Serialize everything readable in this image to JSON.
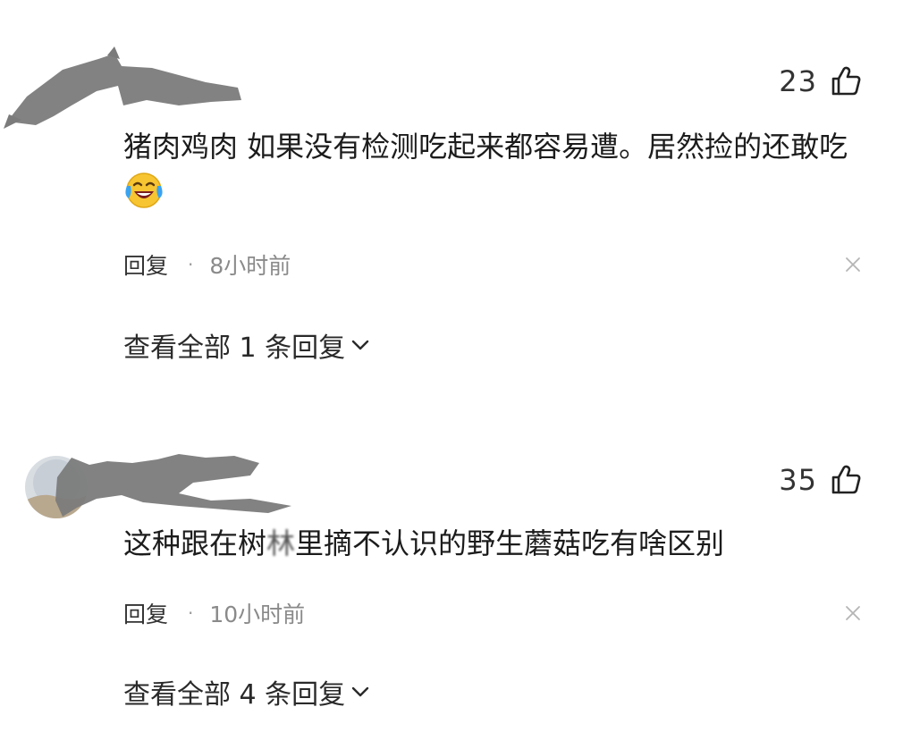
{
  "comments": [
    {
      "likes": "23",
      "text": "猪肉鸡肉 如果没有检测吃起来都容易遭。居然捡的还敢吃",
      "emoji": "laughing-crying-emoji",
      "reply_label": "回复",
      "separator": "·",
      "timestamp": "8小时前",
      "view_replies": "查看全部 1 条回复"
    },
    {
      "likes": "35",
      "text_before_blur": "这种跟在树",
      "text_blurred": "林",
      "text_after_blur": "里摘不认识的野生蘑菇吃有啥区别",
      "reply_label": "回复",
      "separator": "·",
      "timestamp": "10小时前",
      "view_replies": "查看全部 4 条回复"
    }
  ],
  "colors": {
    "redaction": "#7b7b7b",
    "text": "#1c1c1c",
    "muted": "#8a8a8a",
    "emoji_face": "#f7c531"
  }
}
